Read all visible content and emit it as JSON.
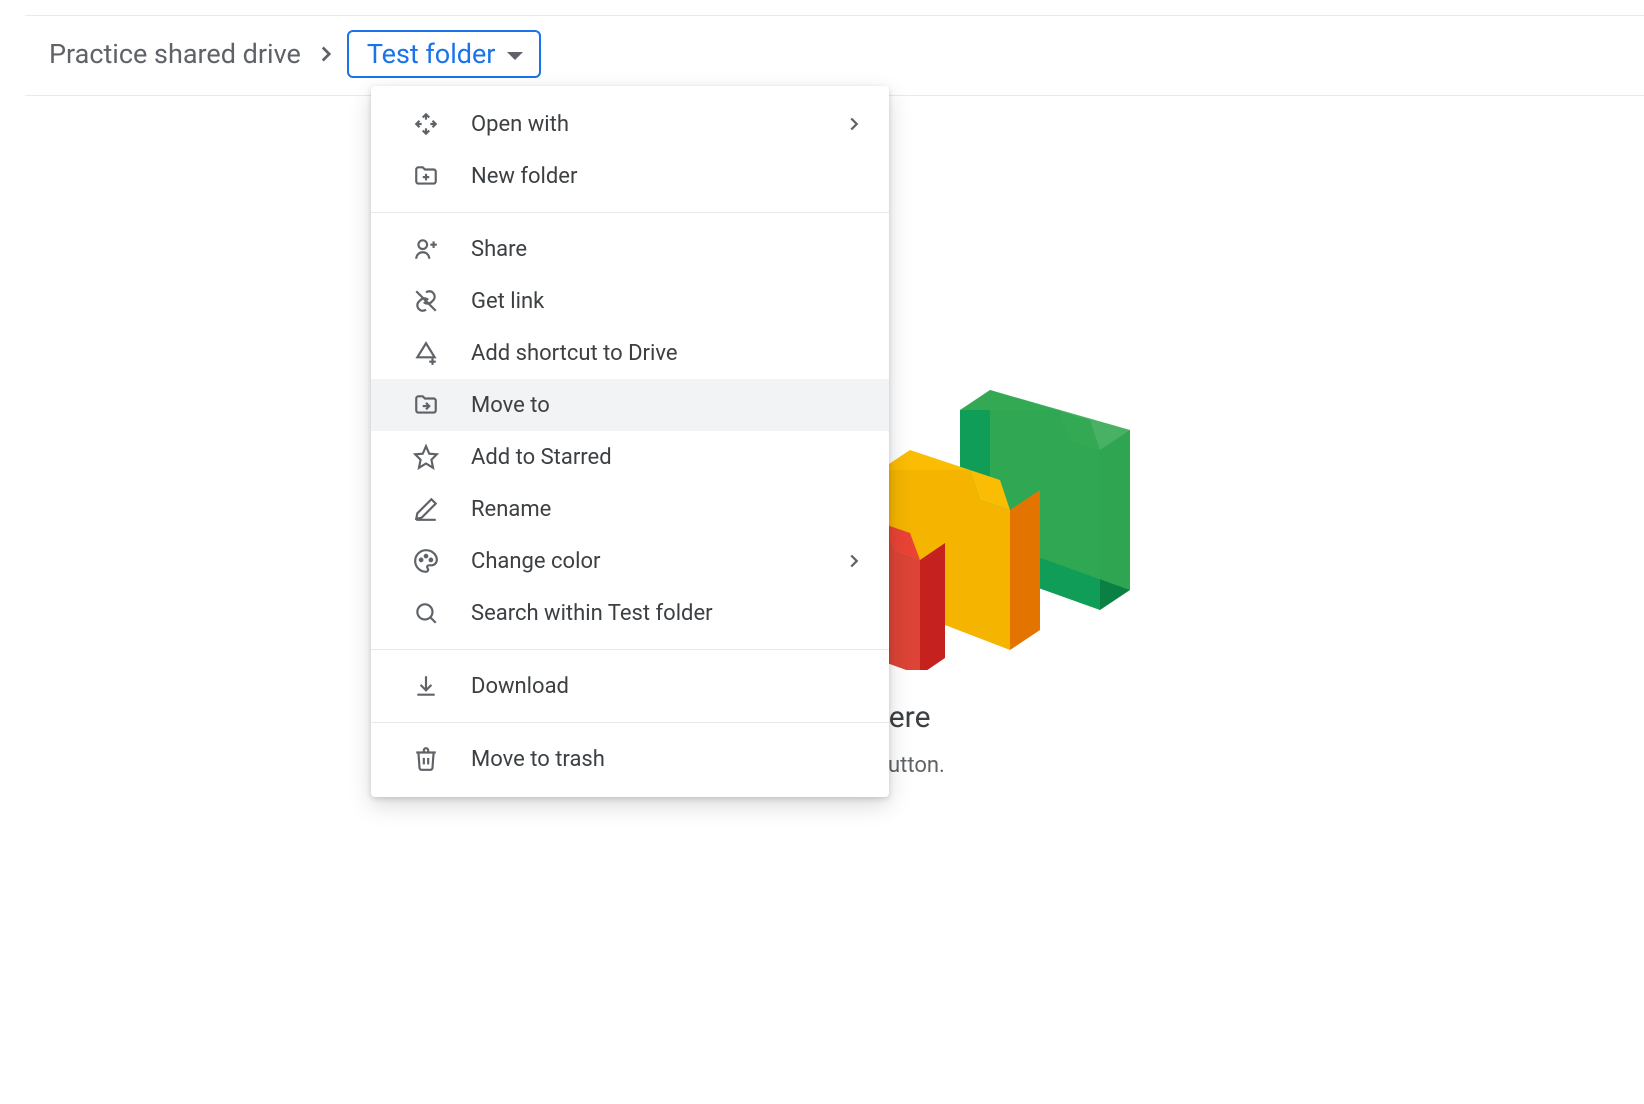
{
  "breadcrumb": {
    "root": "Practice shared drive",
    "current": "Test folder"
  },
  "menu": {
    "open_with": "Open with",
    "new_folder": "New folder",
    "share": "Share",
    "get_link": "Get link",
    "add_shortcut": "Add shortcut to Drive",
    "move_to": "Move to",
    "add_starred": "Add to Starred",
    "rename": "Rename",
    "change_color": "Change color",
    "search_within": "Search within Test folder",
    "download": "Download",
    "move_trash": "Move to trash"
  },
  "empty_state": {
    "title_partial": "files here",
    "subtitle_partial": "e \"New\" button."
  }
}
